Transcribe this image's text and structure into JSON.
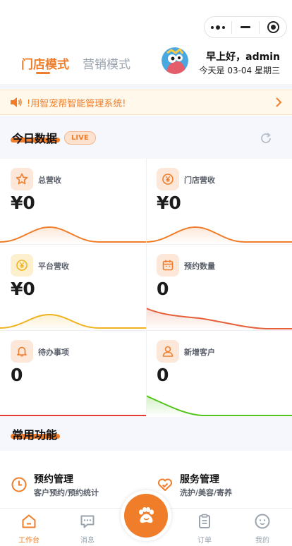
{
  "header": {
    "tabs": [
      {
        "label": "门店模式"
      },
      {
        "label": "营销模式"
      }
    ],
    "greeting": "早上好，admin",
    "date_line": "今天是 03-04 星期三"
  },
  "notice": {
    "text": "!用智宠帮智能管理系统!"
  },
  "today": {
    "title": "今日数据",
    "badge": "LIVE",
    "cards": [
      {
        "label": "总营收",
        "value": "¥0",
        "icon": "star-icon",
        "color": "#ef7d2a"
      },
      {
        "label": "门店营收",
        "value": "¥0",
        "icon": "yen-coin-icon",
        "color": "#ef7d2a"
      },
      {
        "label": "平台营收",
        "value": "¥0",
        "icon": "yen-coin-icon",
        "color": "#f0b21e"
      },
      {
        "label": "预约数量",
        "value": "0",
        "icon": "calendar-icon",
        "color": "#e5603a"
      },
      {
        "label": "待办事项",
        "value": "0",
        "icon": "bell-icon",
        "color": "#ef7d2a"
      },
      {
        "label": "新增客户",
        "value": "0",
        "icon": "user-icon",
        "color": "#ef7d2a"
      }
    ]
  },
  "functions": {
    "title": "常用功能",
    "items": [
      {
        "title": "预约管理",
        "subtitle": "客户预约/预约统计",
        "icon": "clock-icon"
      },
      {
        "title": "服务管理",
        "subtitle": "洗护/美容/寄养",
        "icon": "heart-icon"
      }
    ]
  },
  "tabbar": {
    "items": [
      {
        "label": "工作台"
      },
      {
        "label": "消息"
      },
      {
        "label": "订单"
      },
      {
        "label": "我的"
      }
    ]
  },
  "colors": {
    "accent": "#ef7d2a",
    "platform": "#f0b21e",
    "appointments": "#e5603a",
    "todo": "#e53935",
    "customers": "#52c41a"
  }
}
